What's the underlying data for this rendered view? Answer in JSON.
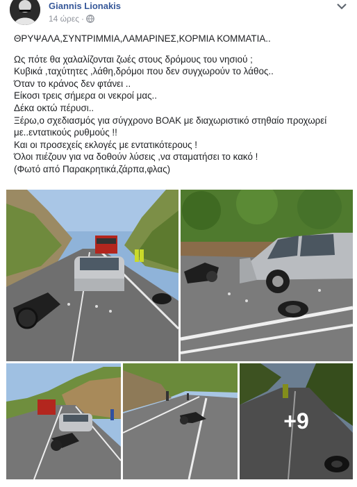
{
  "post": {
    "author": "Giannis Lionakis",
    "time": "14 ώρες",
    "separator": "·",
    "privacy_icon": "globe-icon",
    "more_icon": "chevron-down-icon",
    "headline": "ΘΡΥΨΑΛΑ,ΣΥΝΤΡΙΜΜΙΑ,ΛΑΜΑΡΙΝΕΣ,ΚΟΡΜΙΑ ΚΟΜΜΑΤΙΑ..",
    "lines": [
      "Ως πότε θα χαλαλίζονται ζωές στους δρόμους του νησιού ;",
      "Κυβικά ,ταχύτητες ,λάθη,δρόμοι που δεν συγχωρούν το λάθος..",
      "Όταν το κράνος δεν φτάνει ..",
      "Είκοσι τρεις σήμερα οι νεκροί μας..",
      "Δέκα οκτώ πέρυσι..",
      "Ξέρω,ο σχεδιασμός για σύγχρονο ΒΟΑΚ με διαχωριστικό στηθαίο προχωρεί",
      "με..εντατικούς ρυθμούς !!",
      "Και οι προσεχείς εκλογές με εντατικότερους !",
      "Όλοι πιέζουν για να δοθούν λύσεις ,να σταματήσει το κακό !",
      "(Φωτό από Παρακρητικά,ζάρπα,φλας)"
    ]
  },
  "photos": {
    "items": [
      {
        "label": "accident-photo-1"
      },
      {
        "label": "accident-photo-2"
      },
      {
        "label": "accident-photo-3"
      },
      {
        "label": "accident-photo-4"
      },
      {
        "label": "accident-photo-5"
      }
    ],
    "more_count": "+9"
  },
  "colors": {
    "author_link": "#365899",
    "meta_gray": "#90949c",
    "text": "#1c1e21"
  }
}
